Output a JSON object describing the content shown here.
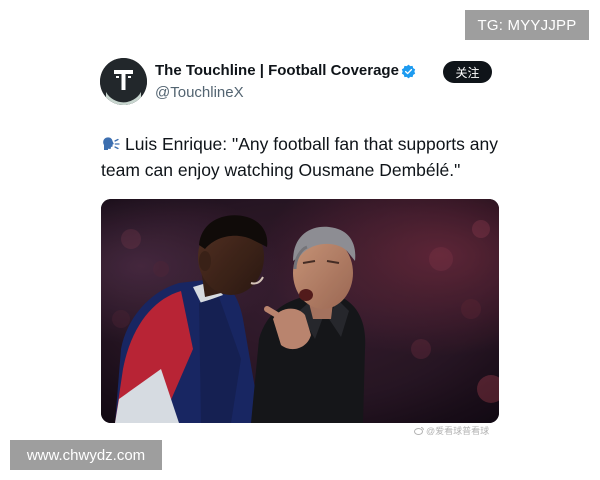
{
  "overlay": {
    "tg_badge": "TG: MYYJJPP",
    "site_badge": "www.chwydz.com",
    "photo_watermark": "@爱看球普看球"
  },
  "tweet": {
    "account_name": "The Touchline | Football Coverage",
    "handle": "@TouchlineX",
    "verified": true,
    "follow_label": "关注",
    "speaker_icon": "speaking-head-icon",
    "text": "Luis Enrique: \"Any football fan that supports any team can enjoy watching Ousmane Dembélé.\"",
    "avatar_letter": "T"
  },
  "colors": {
    "verified_blue": "#1d9bf0",
    "follow_button_bg": "#0f1419",
    "badge_gray": "#9e9e9e"
  }
}
